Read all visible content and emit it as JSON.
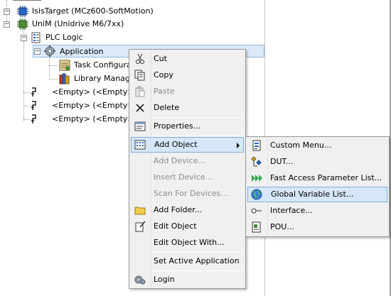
{
  "tree": {
    "items": [
      {
        "label": "IsisTarget (MCz600-SoftMotion)",
        "icon": "device-chip-icon"
      },
      {
        "label": "UniM (Unidrive M6/7xx)",
        "icon": "device-chip-icon"
      },
      {
        "label": "PLC Logic",
        "icon": "plc-logic-icon"
      },
      {
        "label": "Application",
        "icon": "application-gear-icon"
      },
      {
        "label": "Task Configurati",
        "icon": "task-configuration-icon"
      },
      {
        "label": "Library Manager",
        "icon": "library-manager-icon"
      },
      {
        "label": "<Empty> (<Empty>)",
        "icon": "empty-slot-icon"
      },
      {
        "label": "<Empty> (<Empty>)",
        "icon": "empty-slot-icon"
      },
      {
        "label": "<Empty> (<Empty>)",
        "icon": "empty-slot-icon"
      }
    ]
  },
  "context_menu": {
    "items": [
      {
        "label": "Cut",
        "icon": "scissors-icon",
        "enabled": true
      },
      {
        "label": "Copy",
        "icon": "copy-icon",
        "enabled": true
      },
      {
        "label": "Paste",
        "icon": "paste-icon",
        "enabled": false
      },
      {
        "label": "Delete",
        "icon": "delete-x-icon",
        "enabled": true
      },
      {
        "label": "Properties...",
        "icon": "properties-icon",
        "enabled": true
      },
      {
        "label": "Add Object",
        "icon": "add-object-icon",
        "enabled": true,
        "highlighted": true,
        "has_submenu": true
      },
      {
        "label": "Add Device...",
        "enabled": false
      },
      {
        "label": "Insert Device...",
        "enabled": false
      },
      {
        "label": "Scan For Devices...",
        "enabled": false
      },
      {
        "label": "Add Folder...",
        "icon": "folder-icon",
        "enabled": true
      },
      {
        "label": "Edit Object",
        "icon": "edit-object-icon",
        "enabled": true
      },
      {
        "label": "Edit Object With...",
        "enabled": true
      },
      {
        "label": "Set Active Application",
        "enabled": true
      },
      {
        "label": "Login",
        "icon": "login-gear-icon",
        "enabled": true
      }
    ]
  },
  "submenu": {
    "items": [
      {
        "label": "Custom Menu...",
        "icon": "custom-menu-icon"
      },
      {
        "label": "DUT...",
        "icon": "dut-icon"
      },
      {
        "label": "Fast Access Parameter List...",
        "icon": "fast-access-arrows-icon"
      },
      {
        "label": "Global Variable List...",
        "icon": "globe-icon",
        "highlighted": true
      },
      {
        "label": "Interface...",
        "icon": "interface-icon"
      },
      {
        "label": "POU...",
        "icon": "pou-icon"
      }
    ]
  },
  "colors": {
    "selection_bg": "#dbe9f8",
    "menu_bg": "#f0f0f0",
    "highlight_bg": "#d5e7f8",
    "disabled_text": "#8d8d8d"
  }
}
